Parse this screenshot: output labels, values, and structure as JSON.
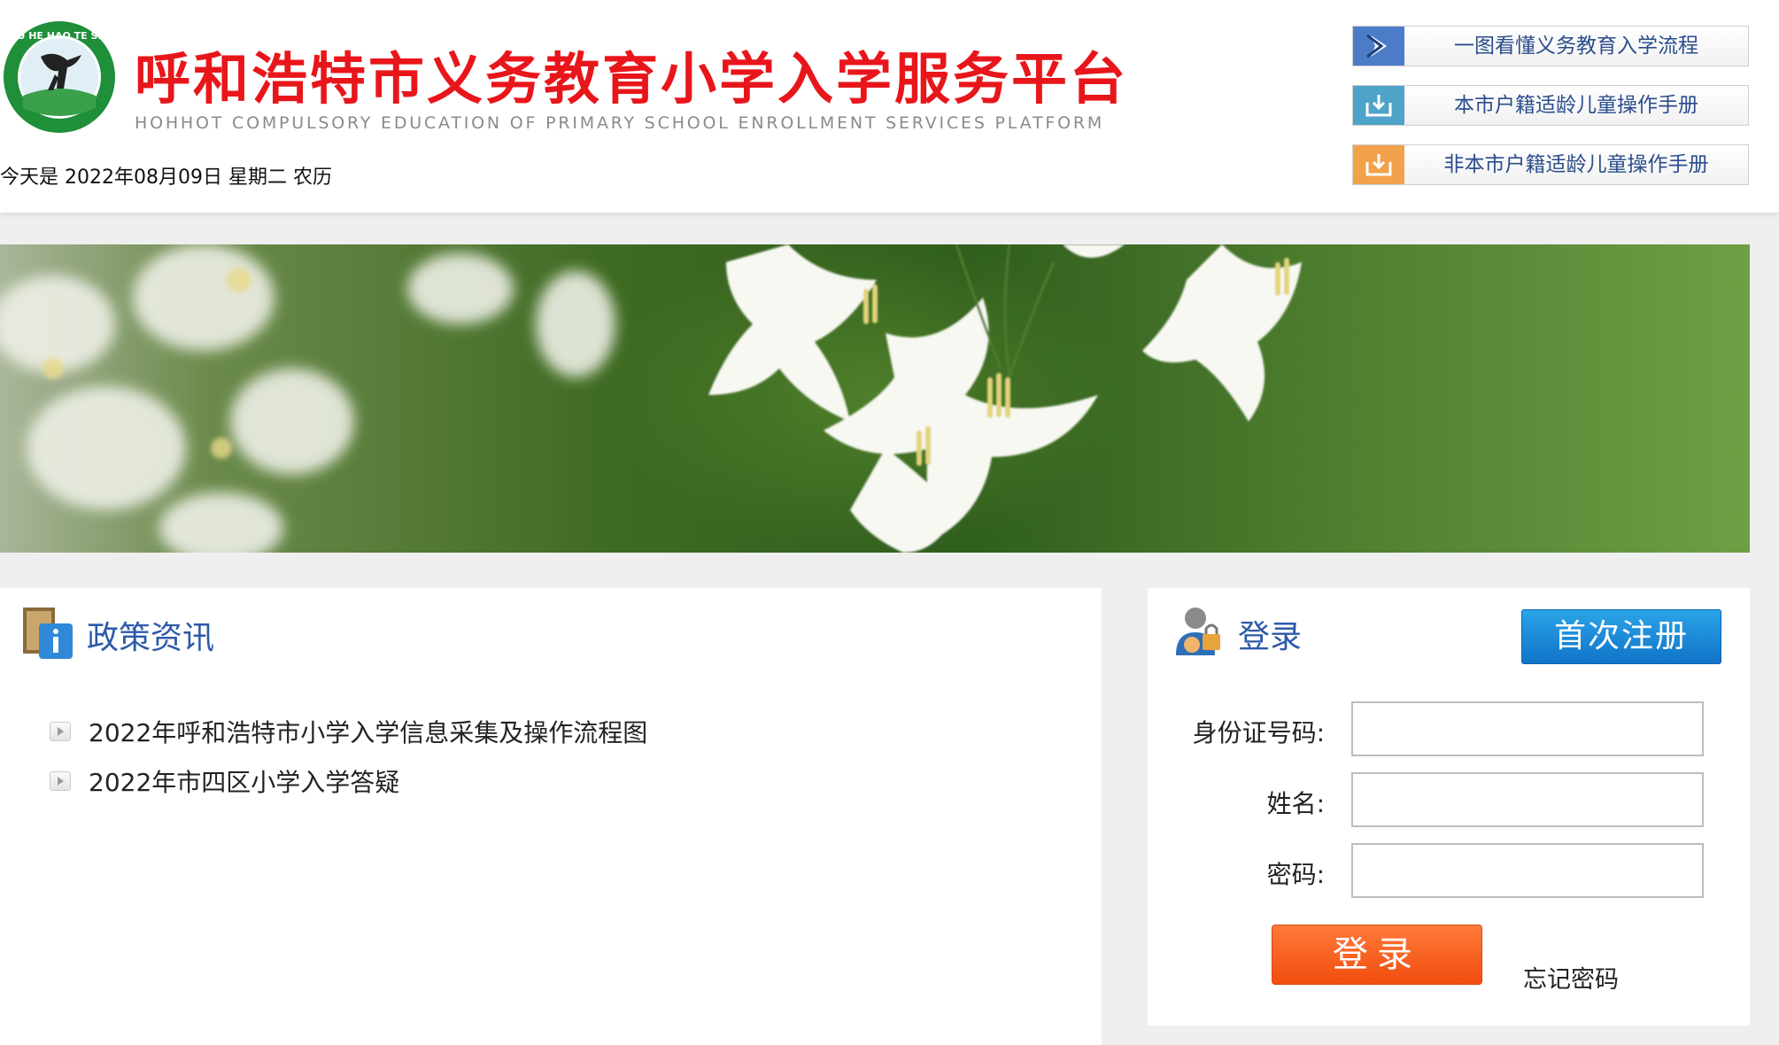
{
  "header": {
    "title": "呼和浩特市义务教育小学入学服务平台",
    "subtitle": "HOHHOT COMPULSORY EDUCATION OF PRIMARY SCHOOL ENROLLMENT SERVICES PLATFORM",
    "date_text": "今天是 2022年08月09日 星期二 农历",
    "logo_text": "HU HE HAO TE SHI"
  },
  "quick_links": [
    {
      "label": "一图看懂义务教育入学流程",
      "icon": "chevron-right-icon",
      "color": "#4c7cc8"
    },
    {
      "label": "本市户籍适龄儿童操作手册",
      "icon": "download-icon",
      "color": "#4fa3c9"
    },
    {
      "label": "非本市户籍适龄儿童操作手册",
      "icon": "download-icon",
      "color": "#f1a24a"
    }
  ],
  "policy": {
    "heading": "政策资讯",
    "items": [
      {
        "label": "2022年呼和浩特市小学入学信息采集及操作流程图"
      },
      {
        "label": "2022年市四区小学入学答疑"
      }
    ]
  },
  "login": {
    "heading": "登录",
    "register_label": "首次注册",
    "id_label": "身份证号码:",
    "name_label": "姓名:",
    "password_label": "密码:",
    "id_value": "",
    "name_value": "",
    "password_value": "",
    "submit_label": "登录",
    "forgot_label": "忘记密码"
  },
  "colors": {
    "title_red": "#e8161b",
    "link_blue": "#2b4d8c",
    "heading_blue": "#2d5aa8",
    "register_blue": "#1b8bd8",
    "login_orange": "#f35f1f"
  }
}
